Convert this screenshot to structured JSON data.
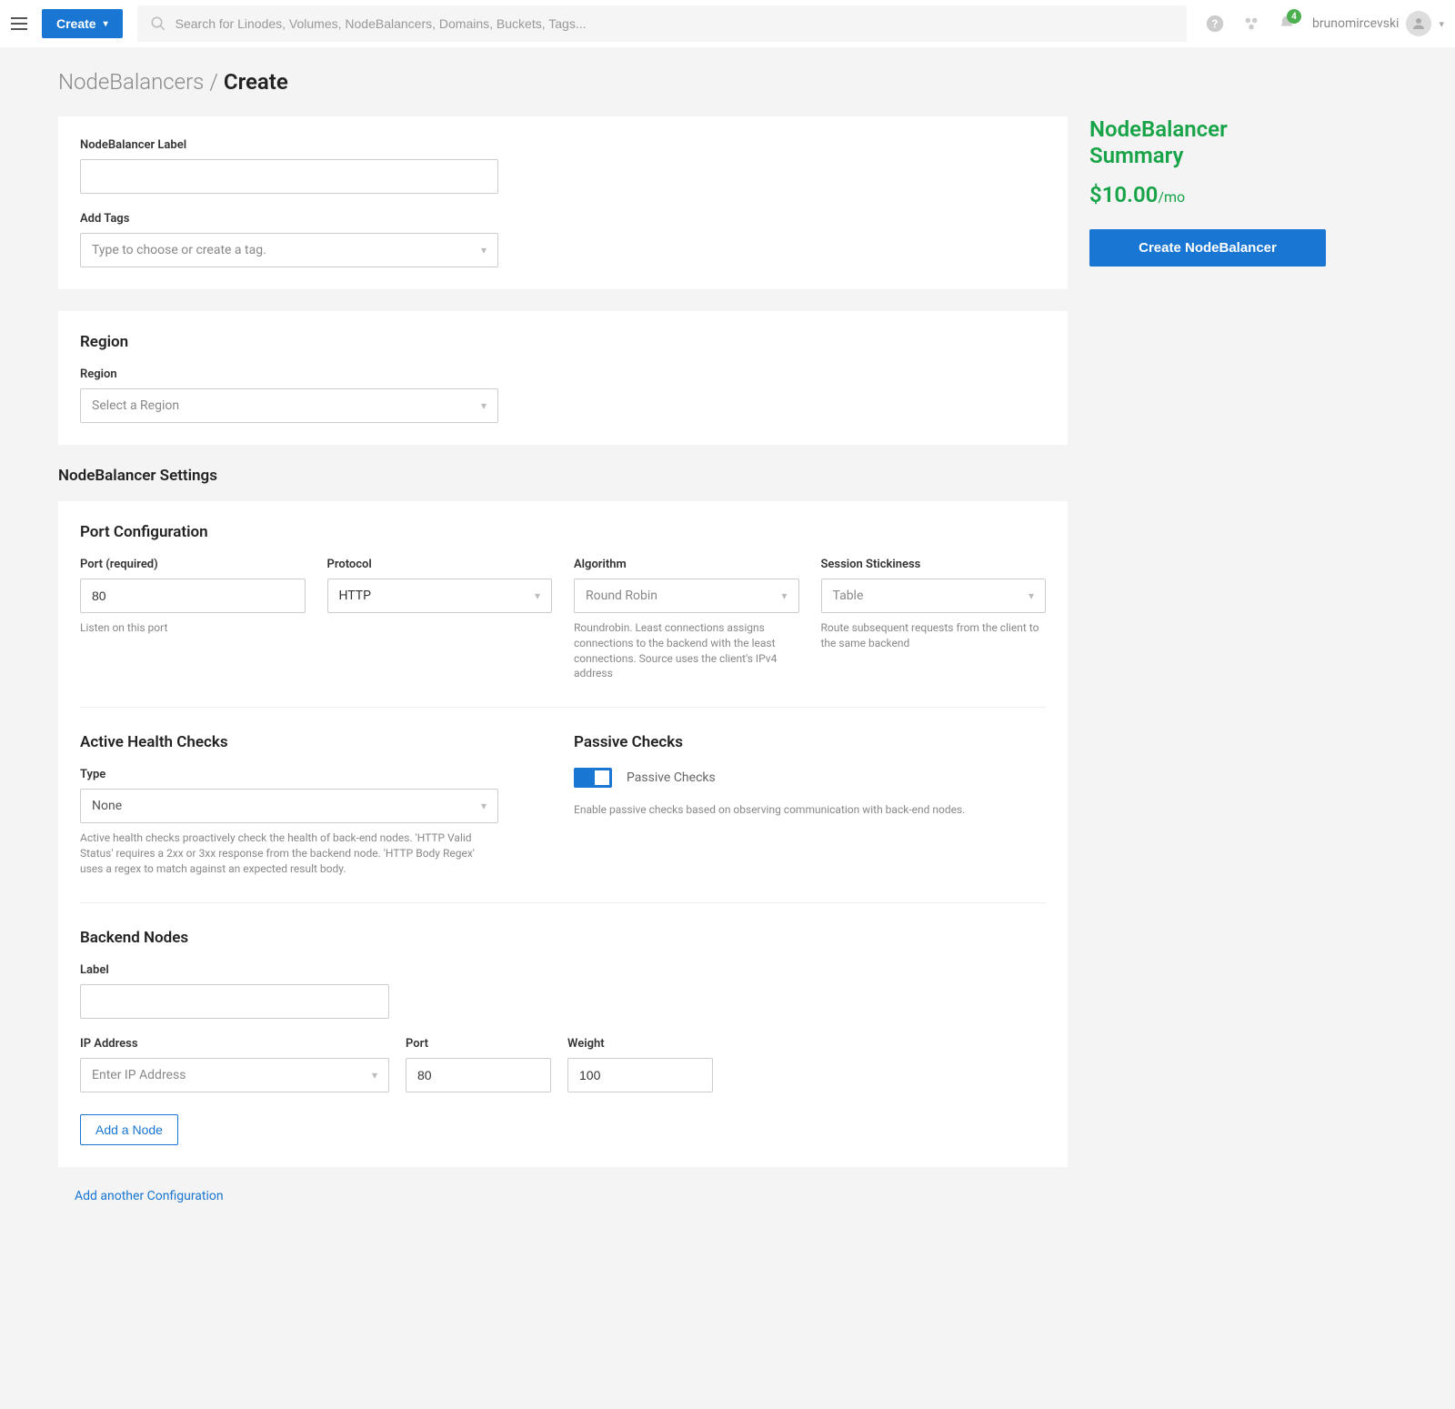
{
  "header": {
    "create_label": "Create",
    "search_placeholder": "Search for Linodes, Volumes, NodeBalancers, Domains, Buckets, Tags...",
    "notification_count": "4",
    "username": "brunomircevski"
  },
  "breadcrumb": {
    "parent": "NodeBalancers",
    "sep": "/",
    "current": "Create"
  },
  "labels_card": {
    "label_title": "NodeBalancer Label",
    "tags_title": "Add Tags",
    "tags_placeholder": "Type to choose or create a tag."
  },
  "region_card": {
    "title": "Region",
    "field_label": "Region",
    "placeholder": "Select a Region"
  },
  "settings_title": "NodeBalancer Settings",
  "port_config": {
    "title": "Port Configuration",
    "port_label": "Port (required)",
    "port_value": "80",
    "port_helper": "Listen on this port",
    "protocol_label": "Protocol",
    "protocol_value": "HTTP",
    "algorithm_label": "Algorithm",
    "algorithm_value": "Round Robin",
    "algorithm_helper": "Roundrobin. Least connections assigns connections to the backend with the least connections. Source uses the client's IPv4 address",
    "stickiness_label": "Session Stickiness",
    "stickiness_value": "Table",
    "stickiness_helper": "Route subsequent requests from the client to the same backend"
  },
  "active_checks": {
    "title": "Active Health Checks",
    "type_label": "Type",
    "type_value": "None",
    "helper": "Active health checks proactively check the health of back-end nodes. 'HTTP Valid Status' requires a 2xx or 3xx response from the backend node. 'HTTP Body Regex' uses a regex to match against an expected result body."
  },
  "passive_checks": {
    "title": "Passive Checks",
    "toggle_label": "Passive Checks",
    "helper": "Enable passive checks based on observing communication with back-end nodes."
  },
  "backend": {
    "title": "Backend Nodes",
    "label_label": "Label",
    "ip_label": "IP Address",
    "ip_placeholder": "Enter IP Address",
    "port_label": "Port",
    "port_value": "80",
    "weight_label": "Weight",
    "weight_value": "100",
    "add_node_label": "Add a Node"
  },
  "add_config_label": "Add another Configuration",
  "summary": {
    "title_line1": "NodeBalancer",
    "title_line2": "Summary",
    "price": "$10.00",
    "price_suffix": "/mo",
    "create_button": "Create NodeBalancer"
  }
}
